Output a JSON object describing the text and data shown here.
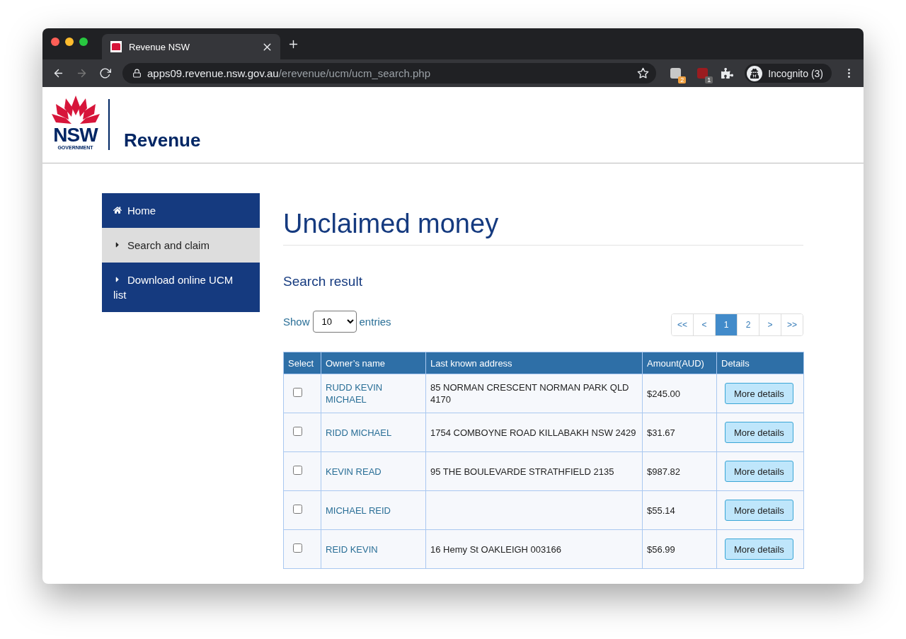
{
  "browser": {
    "tab": {
      "title": "Revenue NSW"
    },
    "url": {
      "host": "apps09.revenue.nsw.gov.au",
      "path": "/erevenue/ucm/ucm_search.php"
    },
    "forward_disabled": true,
    "extensions": [
      {
        "badge": "2",
        "color": "#f0a040"
      },
      {
        "badge": "1",
        "color": "#666666"
      }
    ],
    "profile": "Incognito (3)"
  },
  "header": {
    "logo_word": "NSW",
    "logo_sub": "GOVERNMENT",
    "brand": "Revenue"
  },
  "sidebar": {
    "items": [
      {
        "label": "Home",
        "kind": "home",
        "selected": false
      },
      {
        "label": "Search and claim",
        "kind": "caret",
        "selected": true
      },
      {
        "label": "Download online UCM list",
        "kind": "caret",
        "selected": false
      }
    ]
  },
  "main": {
    "title": "Unclaimed money",
    "subtitle": "Search result",
    "show_label": "Show",
    "page_size": "10",
    "entries_label": "entries",
    "pagination": [
      {
        "label": "<<",
        "selected": false
      },
      {
        "label": "<",
        "selected": false
      },
      {
        "label": "1",
        "selected": true
      },
      {
        "label": "2",
        "selected": false
      },
      {
        "label": ">",
        "selected": false
      },
      {
        "label": ">>",
        "selected": false
      }
    ],
    "table": {
      "columns": [
        "Select",
        "Owner’s name",
        "Last known address",
        "Amount(AUD)",
        "Details"
      ],
      "rows": [
        {
          "checked": false,
          "name": "RUDD KEVIN MICHAEL",
          "address": "85 NORMAN CRESCENT NORMAN PARK QLD 4170",
          "amount": "$245.00",
          "action": "More details"
        },
        {
          "checked": false,
          "name": "RIDD MICHAEL",
          "address": "1754 COMBOYNE ROAD KILLABAKH NSW 2429",
          "amount": "$31.67",
          "action": "More details"
        },
        {
          "checked": false,
          "name": "KEVIN READ",
          "address": "95 THE BOULEVARDE STRATHFIELD 2135",
          "amount": "$987.82",
          "action": "More details"
        },
        {
          "checked": false,
          "name": "MICHAEL REID",
          "address": "",
          "amount": "$55.14",
          "action": "More details"
        },
        {
          "checked": false,
          "name": "REID KEVIN",
          "address": "16 Hemy St OAKLEIGH 003166",
          "amount": "$56.99",
          "action": "More details"
        }
      ]
    }
  }
}
